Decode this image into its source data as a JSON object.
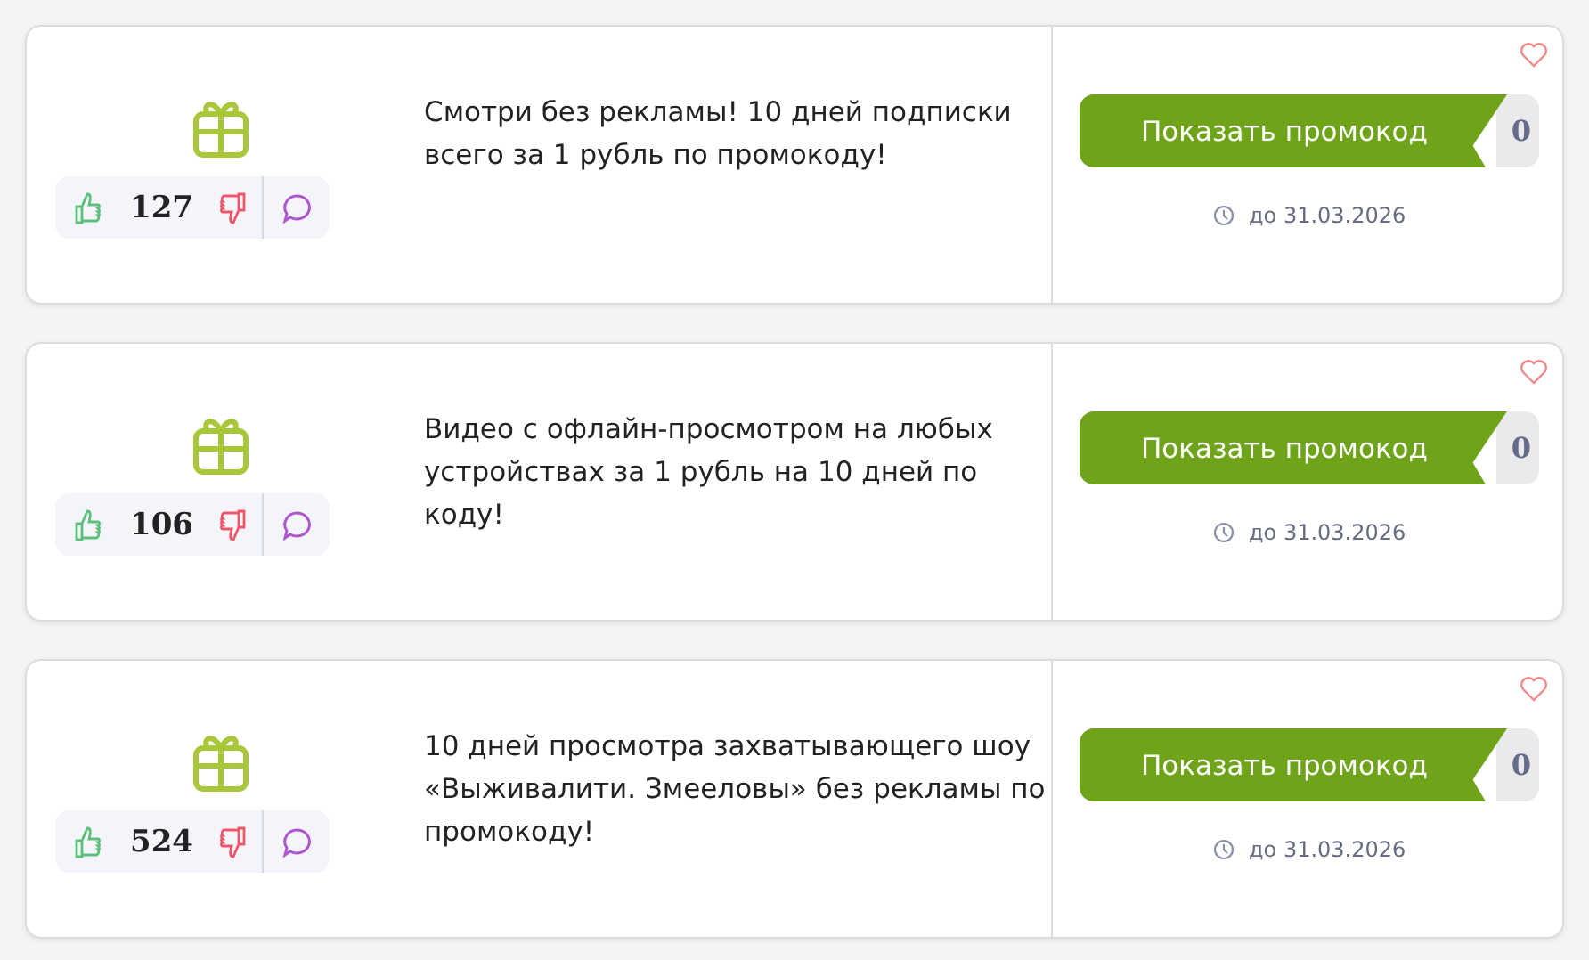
{
  "offers": [
    {
      "rating": "127",
      "description": "Смотри без рекламы! 10 дней подписки всего за 1 рубль по промокоду!",
      "button": "Показать промокод",
      "uses": "0",
      "expires": "до 31.03.2026"
    },
    {
      "rating": "106",
      "description": "Видео с офлайн-просмотром на любых устройствах за 1 рубль на 10 дней по коду!",
      "button": "Показать промокод",
      "uses": "0",
      "expires": "до 31.03.2026"
    },
    {
      "rating": "524",
      "description": "10 дней просмотра захватывающего шоу «Выживалити. Змееловы» без рекламы по промокоду!",
      "button": "Показать промокод",
      "uses": "0",
      "expires": "до 31.03.2026"
    }
  ]
}
